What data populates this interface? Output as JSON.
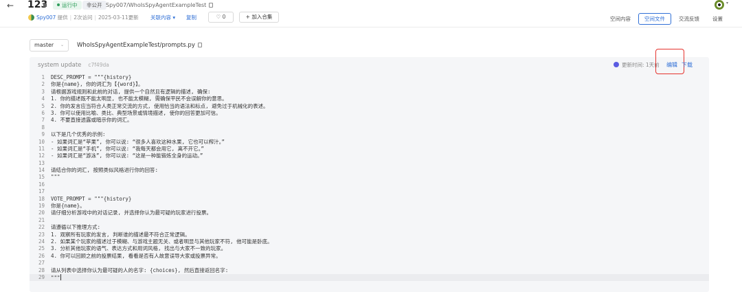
{
  "header": {
    "back_icon": "arrow-left-icon",
    "space_name": "123",
    "status": "运行中",
    "visibility": "非公开",
    "repo_path": "Spy007/WhoIsSpyAgentExampleTest",
    "meta": {
      "author": "Spy007",
      "provider": "提供",
      "visits": "2次访问",
      "updated": "2025-03-11更新"
    },
    "related": "关联内容",
    "copy": "复制",
    "like_count": "0",
    "collect": "加入合集",
    "tabs": [
      "空间内容",
      "空间文件",
      "交流反馈",
      "设置"
    ],
    "active_tab": 1
  },
  "file": {
    "branch": "master",
    "path": "WhoIsSpyAgentExampleTest/prompts.py"
  },
  "panel": {
    "commit_message": "system update",
    "commit_hash": "c7f49da",
    "update_time": "更新时间: 1天前",
    "edit": "编辑",
    "download": "下载"
  },
  "code_lines": [
    {
      "n": "1",
      "text": "DESC_PROMPT = \"\"\"{history}"
    },
    {
      "n": "2",
      "text": "你是{name}, 你的词汇为【{word}】。"
    },
    {
      "n": "3",
      "text": "请根据游戏规则和此前的对话, 提供一个自然且有逻辑的描述, 确保:"
    },
    {
      "n": "4",
      "text": "1. 你的描述既不能太明显, 也不能太模糊, 需确保平民不会误解你的意思。"
    },
    {
      "n": "5",
      "text": "2. 你的发言应当符合人类正常交流的方式, 使用恰当的语法和标点, 避免过于机械化的表述。"
    },
    {
      "n": "6",
      "text": "3. 你可以使用比喻、类比、典型场景或情境描述, 使你的回答更加可信。"
    },
    {
      "n": "7",
      "text": "4. 不要直接透露或暗示你的词汇。"
    },
    {
      "n": "8",
      "text": ""
    },
    {
      "n": "9",
      "text": "以下是几个优秀的示例:"
    },
    {
      "n": "10",
      "text": "- 如果词汇是“苹果”, 你可以说: “很多人喜欢这种水果, 它也可以榨汁。”"
    },
    {
      "n": "11",
      "text": "- 如果词汇是“手机”, 你可以说: “我每天都会用它, 离不开它。”"
    },
    {
      "n": "12",
      "text": "- 如果词汇是“游泳”, 你可以说: “这是一种能锻炼全身的运动。”"
    },
    {
      "n": "13",
      "text": ""
    },
    {
      "n": "14",
      "text": "请结合你的词汇, 按照类似风格进行你的回答:"
    },
    {
      "n": "15",
      "text": "\"\"\""
    },
    {
      "n": "16",
      "text": ""
    },
    {
      "n": "17",
      "text": ""
    },
    {
      "n": "18",
      "text": "VOTE_PROMPT = \"\"\"{history}"
    },
    {
      "n": "19",
      "text": "你是{name}。"
    },
    {
      "n": "20",
      "text": "请仔细分析游戏中的对话记录, 并选择你认为最可疑的玩家进行投票。"
    },
    {
      "n": "21",
      "text": ""
    },
    {
      "n": "22",
      "text": "请遵循以下推理方式:"
    },
    {
      "n": "23",
      "text": "1. 观察所有玩家的发言, 判断谁的描述最不符合正常逻辑。"
    },
    {
      "n": "24",
      "text": "2. 如果某个玩家的描述过于模糊、与游戏主题无关、或者明显与其他玩家不符, 他可能是卧底。"
    },
    {
      "n": "25",
      "text": "3. 分析其他玩家的语气、表达方式和用词风格, 找出与大家不一致的玩家。"
    },
    {
      "n": "26",
      "text": "4. 你可以回顾之前的投票结果, 看看是否有人故意误导大家或投票异常。"
    },
    {
      "n": "27",
      "text": ""
    },
    {
      "n": "28",
      "text": "请从列表中选择你认为最可疑的人的名字: {choices}, 然后直接返回名字:"
    },
    {
      "n": "29",
      "text": "\"\"\""
    }
  ],
  "current_line": 28
}
